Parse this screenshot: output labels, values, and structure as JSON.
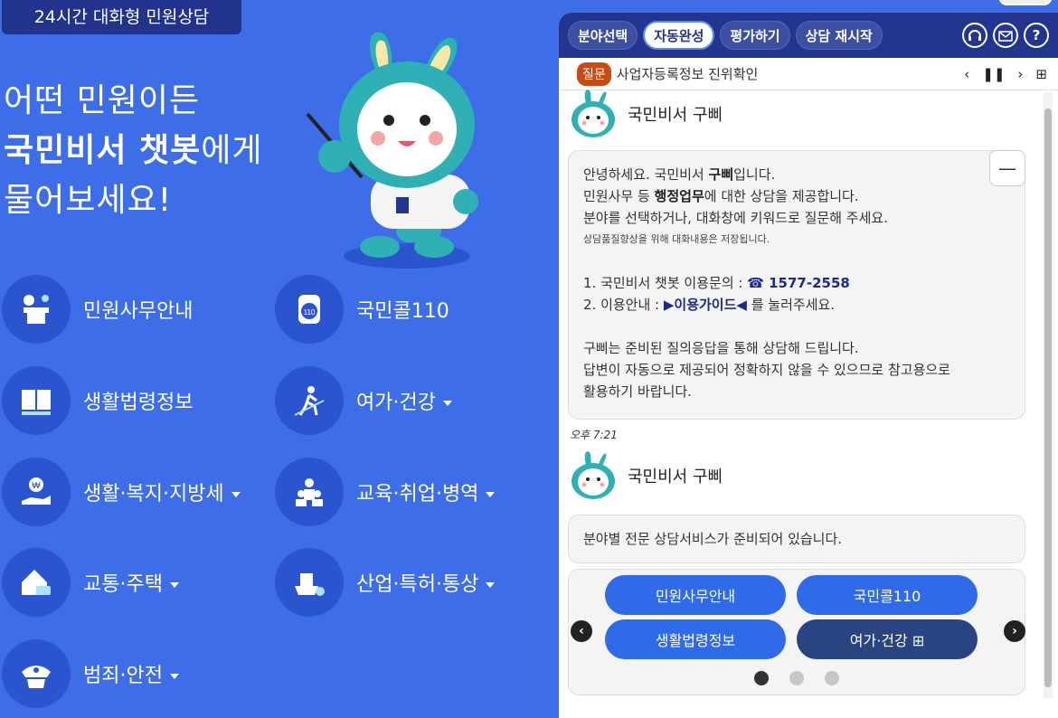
{
  "left": {
    "badge": "24시간 대화형 민원상담",
    "headline": {
      "line1": "어떤 민원이든",
      "line2_bold": "국민비서 챗봇",
      "line2_rest": "에게",
      "line3": "물어보세요!"
    },
    "menu": [
      {
        "label": "민원사무안내",
        "icon": "counter-icon",
        "dropdown": false
      },
      {
        "label": "국민콜110",
        "icon": "phone-110-icon",
        "dropdown": false
      },
      {
        "label": "생활법령정보",
        "icon": "law-book-icon",
        "dropdown": false
      },
      {
        "label": "여가·건강",
        "icon": "hiking-icon",
        "dropdown": true
      },
      {
        "label": "생활·복지·지방세",
        "icon": "welfare-hand-icon",
        "dropdown": true
      },
      {
        "label": "교육·취업·병역",
        "icon": "graduates-icon",
        "dropdown": true
      },
      {
        "label": "교통·주택",
        "icon": "house-car-icon",
        "dropdown": true
      },
      {
        "label": "산업·특허·통상",
        "icon": "ship-award-icon",
        "dropdown": true
      },
      {
        "label": "범죄·안전",
        "icon": "police-cap-icon",
        "dropdown": true
      }
    ]
  },
  "chat": {
    "tabs": [
      "분야선택",
      "자동완성",
      "평가하기",
      "상담 재시작"
    ],
    "active_tab": "자동완성",
    "tool_icons": [
      "headset-icon",
      "mail-icon",
      "help-icon"
    ],
    "question_tag": "질문",
    "question_text": "사업자등록정보 진위확인",
    "question_controls": [
      "prev-icon",
      "pause-icon",
      "next-icon",
      "expand-icon"
    ],
    "bot_name": "국민비서 구삐",
    "message1": {
      "l1a": "안녕하세요. 국민비서 ",
      "l1b": "구삐",
      "l1c": "입니다.",
      "l2a": "민원사무 등 ",
      "l2b": "행정업무",
      "l2c": "에 대한 상담을 제공합니다.",
      "l3": "분야를 선택하거나, 대화창에 키워드로 질문해 주세요.",
      "l4": "상담품질향상을 위해 대화내용은 저장됩니다.",
      "l5a": "1. 국민비서 챗봇 이용문의 : ",
      "l5b": "☎ 1577-2558",
      "l6a": "2. 이용안내 : ",
      "l6b": "▶이용가이드◀",
      "l6c": " 를 눌러주세요.",
      "l7": "구삐는 준비된 질의응답을 통해 상담해 드립니다.",
      "l8": "답변이 자동으로 제공되어 정확하지 않을 수 있으므로 참고용으로",
      "l9": "활용하기 바랍니다."
    },
    "time": "오후 7:21",
    "message2": "분야별 전문 상담서비스가 준비되어 있습니다.",
    "quick_buttons": [
      "민원사무안내",
      "국민콜110",
      "생활법령정보",
      "여가·건강 ⊞"
    ],
    "carousel_pages": 3,
    "carousel_current": 1
  }
}
